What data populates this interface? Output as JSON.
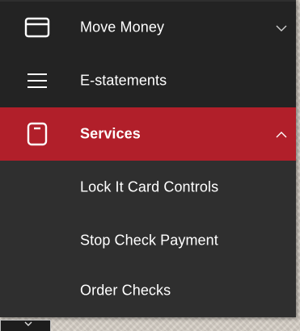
{
  "menu": {
    "items": [
      {
        "label": "Move Money",
        "icon": "card-icon",
        "chevron": "chevron-down-icon"
      },
      {
        "label": "E-statements",
        "icon": "hamburger-icon"
      },
      {
        "label": "Services",
        "icon": "phone-card-icon",
        "chevron": "chevron-up-icon",
        "active": true
      },
      {
        "label": "Lock It Card Controls"
      },
      {
        "label": "Stop Check Payment"
      },
      {
        "label": "Order Checks"
      }
    ]
  },
  "colors": {
    "menu_bg": "#232323",
    "submenu_bg": "#2f2f2f",
    "active_bg": "#b11f2a",
    "text": "#ffffff"
  }
}
